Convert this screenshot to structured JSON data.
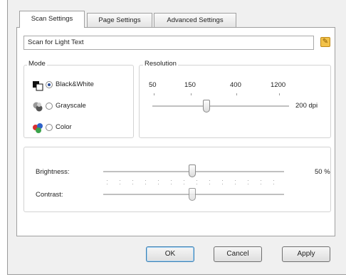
{
  "tabs": [
    {
      "label": "Scan Settings",
      "active": true
    },
    {
      "label": "Page Settings",
      "active": false
    },
    {
      "label": "Advanced Settings",
      "active": false
    }
  ],
  "profile": {
    "value": "Scan for Light Text",
    "edit_icon": "pencil-edit-icon"
  },
  "mode": {
    "title": "Mode",
    "options": [
      {
        "label": "Black&White",
        "checked": true,
        "icon": "black-white-mode-icon"
      },
      {
        "label": "Grayscale",
        "checked": false,
        "icon": "grayscale-mode-icon"
      },
      {
        "label": "Color",
        "checked": false,
        "icon": "color-mode-icon"
      }
    ]
  },
  "resolution": {
    "title": "Resolution",
    "ticks": [
      "50",
      "150",
      "400",
      "1200"
    ],
    "value": 200,
    "value_label": "200 dpi"
  },
  "brightness": {
    "label": "Brightness:",
    "value_percent": 50,
    "value_label": "50 %"
  },
  "contrast": {
    "label": "Contrast:",
    "value_percent": 50
  },
  "buttons": {
    "ok": "OK",
    "cancel": "Cancel",
    "apply": "Apply"
  },
  "colors": {
    "accent": "#2b4f9a",
    "default_button_border": "#3c7fb1"
  }
}
